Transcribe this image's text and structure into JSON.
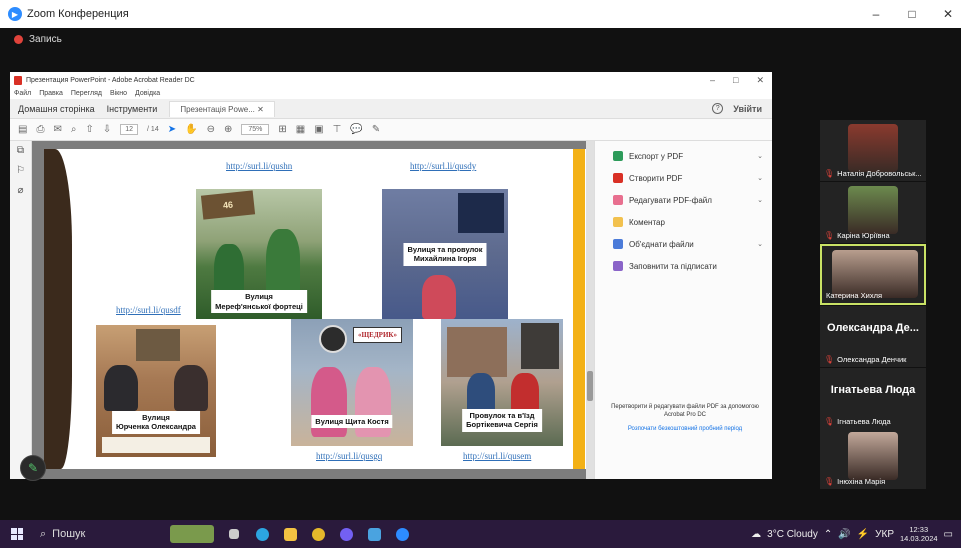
{
  "zoom": {
    "title": "Zoom Конференция",
    "recording_label": "Запись",
    "window_controls": [
      "–",
      "□",
      "✕"
    ]
  },
  "acrobat": {
    "window_title": "Презентация PowerPoint - Adobe Acrobat Reader DC",
    "menu": [
      "Файл",
      "Правка",
      "Перегляд",
      "Вікно",
      "Довідка"
    ],
    "tabs": {
      "home": "Домашня сторінка",
      "tools": "Інструменти",
      "doc": "Презентація Powe... ✕"
    },
    "signin": "Увійти",
    "page_current": "12",
    "page_total": "/ 14",
    "zoom": "75%",
    "right_panel": [
      {
        "label": "Експорт у PDF",
        "color": "#2d9b5a",
        "chevron": true
      },
      {
        "label": "Створити PDF",
        "color": "#d93025",
        "chevron": true
      },
      {
        "label": "Редагувати PDF-файл",
        "color": "#e86f8f",
        "chevron": true
      },
      {
        "label": "Коментар",
        "color": "#f2c14e",
        "chevron": false
      },
      {
        "label": "Об'єднати файли",
        "color": "#4b7bd9",
        "chevron": true
      },
      {
        "label": "Заповнити та підписати",
        "color": "#8a64c8",
        "chevron": false
      }
    ],
    "promo_text": "Перетворити й редагувати файли PDF за допомогою Acrobat Pro DC",
    "promo_link": "Розпочати безкоштовний пробний період"
  },
  "slide": {
    "links": [
      "http://surl.li/qushn",
      "http://surl.li/qusdy",
      "http://surl.li/qusdf",
      "http://surl.li/qusgq",
      "http://surl.li/qusem"
    ],
    "captions": {
      "c1": "Вулиця\nМереф'янської фортеці",
      "c2": "Вулиця та провулок\nМихайлина Ігоря",
      "c3": "Вулиця\nЮрченка Олександра",
      "c4": "Вулиця Щита Костя",
      "c5": "Провулок та в'їзд\nБортiкевича Сергія"
    },
    "badge": "«ЩЕДРИК»",
    "sign": "46"
  },
  "participants": [
    {
      "name": "Наталія Добровольськ...",
      "type": "photo",
      "muted": true,
      "color": "#8a3a2e"
    },
    {
      "name": "Каріна Юріївна",
      "type": "photo",
      "muted": true,
      "color": "#6c8a4e"
    },
    {
      "name": "Катерина Хихля",
      "type": "photo",
      "muted": false,
      "color": "#b89e8e"
    },
    {
      "name": "Олександра Денчик",
      "display": "Олександра Де...",
      "type": "name",
      "muted": true
    },
    {
      "name": "Ігнатьева Люда",
      "display": "Ігнатьева Люда",
      "type": "name",
      "muted": true
    },
    {
      "name": "Інюхіна Марія",
      "type": "photo",
      "muted": true,
      "color": "#c2a89a"
    }
  ],
  "taskbar": {
    "search_placeholder": "Пошук",
    "weather": "3°C Cloudy",
    "lang": "УКР",
    "time": "12:33",
    "date": "14.03.2024"
  }
}
